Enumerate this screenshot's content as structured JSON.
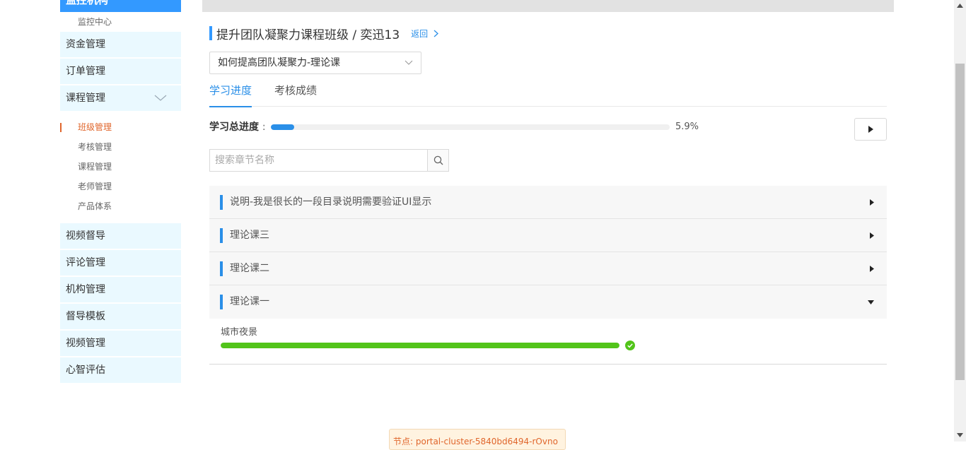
{
  "sidebar": {
    "brand": "监控机构",
    "top_sub": "监控中心",
    "items_before": [
      "资金管理",
      "订单管理"
    ],
    "expanded": {
      "label": "课程管理",
      "children": [
        "班级管理",
        "考核管理",
        "课程管理",
        "老师管理",
        "产品体系"
      ],
      "active_child": "班级管理"
    },
    "items_after": [
      "视频督导",
      "评论管理",
      "机构管理",
      "督导模板",
      "视频管理",
      "心智评估"
    ]
  },
  "header": {
    "title": "提升团队凝聚力课程班级 / 奕迅13",
    "back_label": "返回"
  },
  "course_select": {
    "value": "如何提高团队凝聚力-理论课"
  },
  "tabs": [
    {
      "label": "学习进度",
      "active": true
    },
    {
      "label": "考核成绩",
      "active": false
    }
  ],
  "progress": {
    "label": "学习总进度",
    "colon": ":",
    "value": 5.9,
    "display": "5.9%"
  },
  "search": {
    "placeholder": "搜索章节名称",
    "value": ""
  },
  "chapters": [
    {
      "title": "说明-我是很长的一段目录说明需要验证UI显示",
      "expanded": false
    },
    {
      "title": "理论课三",
      "expanded": false
    },
    {
      "title": "理论课二",
      "expanded": false
    },
    {
      "title": "理论课一",
      "expanded": true
    }
  ],
  "lessons": [
    {
      "title": "城市夜景",
      "progress": 100,
      "completed": true
    }
  ],
  "node_tag": "节点: portal-cluster-5840bd6494-rOvno",
  "colors": {
    "primary": "#2a8fe8",
    "active_sub": "#e0662c",
    "menu_bg": "#eaf9ff",
    "success": "#52c41a"
  },
  "icons": {
    "back": "chevron-right-icon",
    "select": "chevron-down-icon",
    "play": "play-icon",
    "search": "search-icon",
    "collapsed": "caret-right-icon",
    "expanded": "caret-down-icon",
    "done": "check-circle-icon"
  }
}
